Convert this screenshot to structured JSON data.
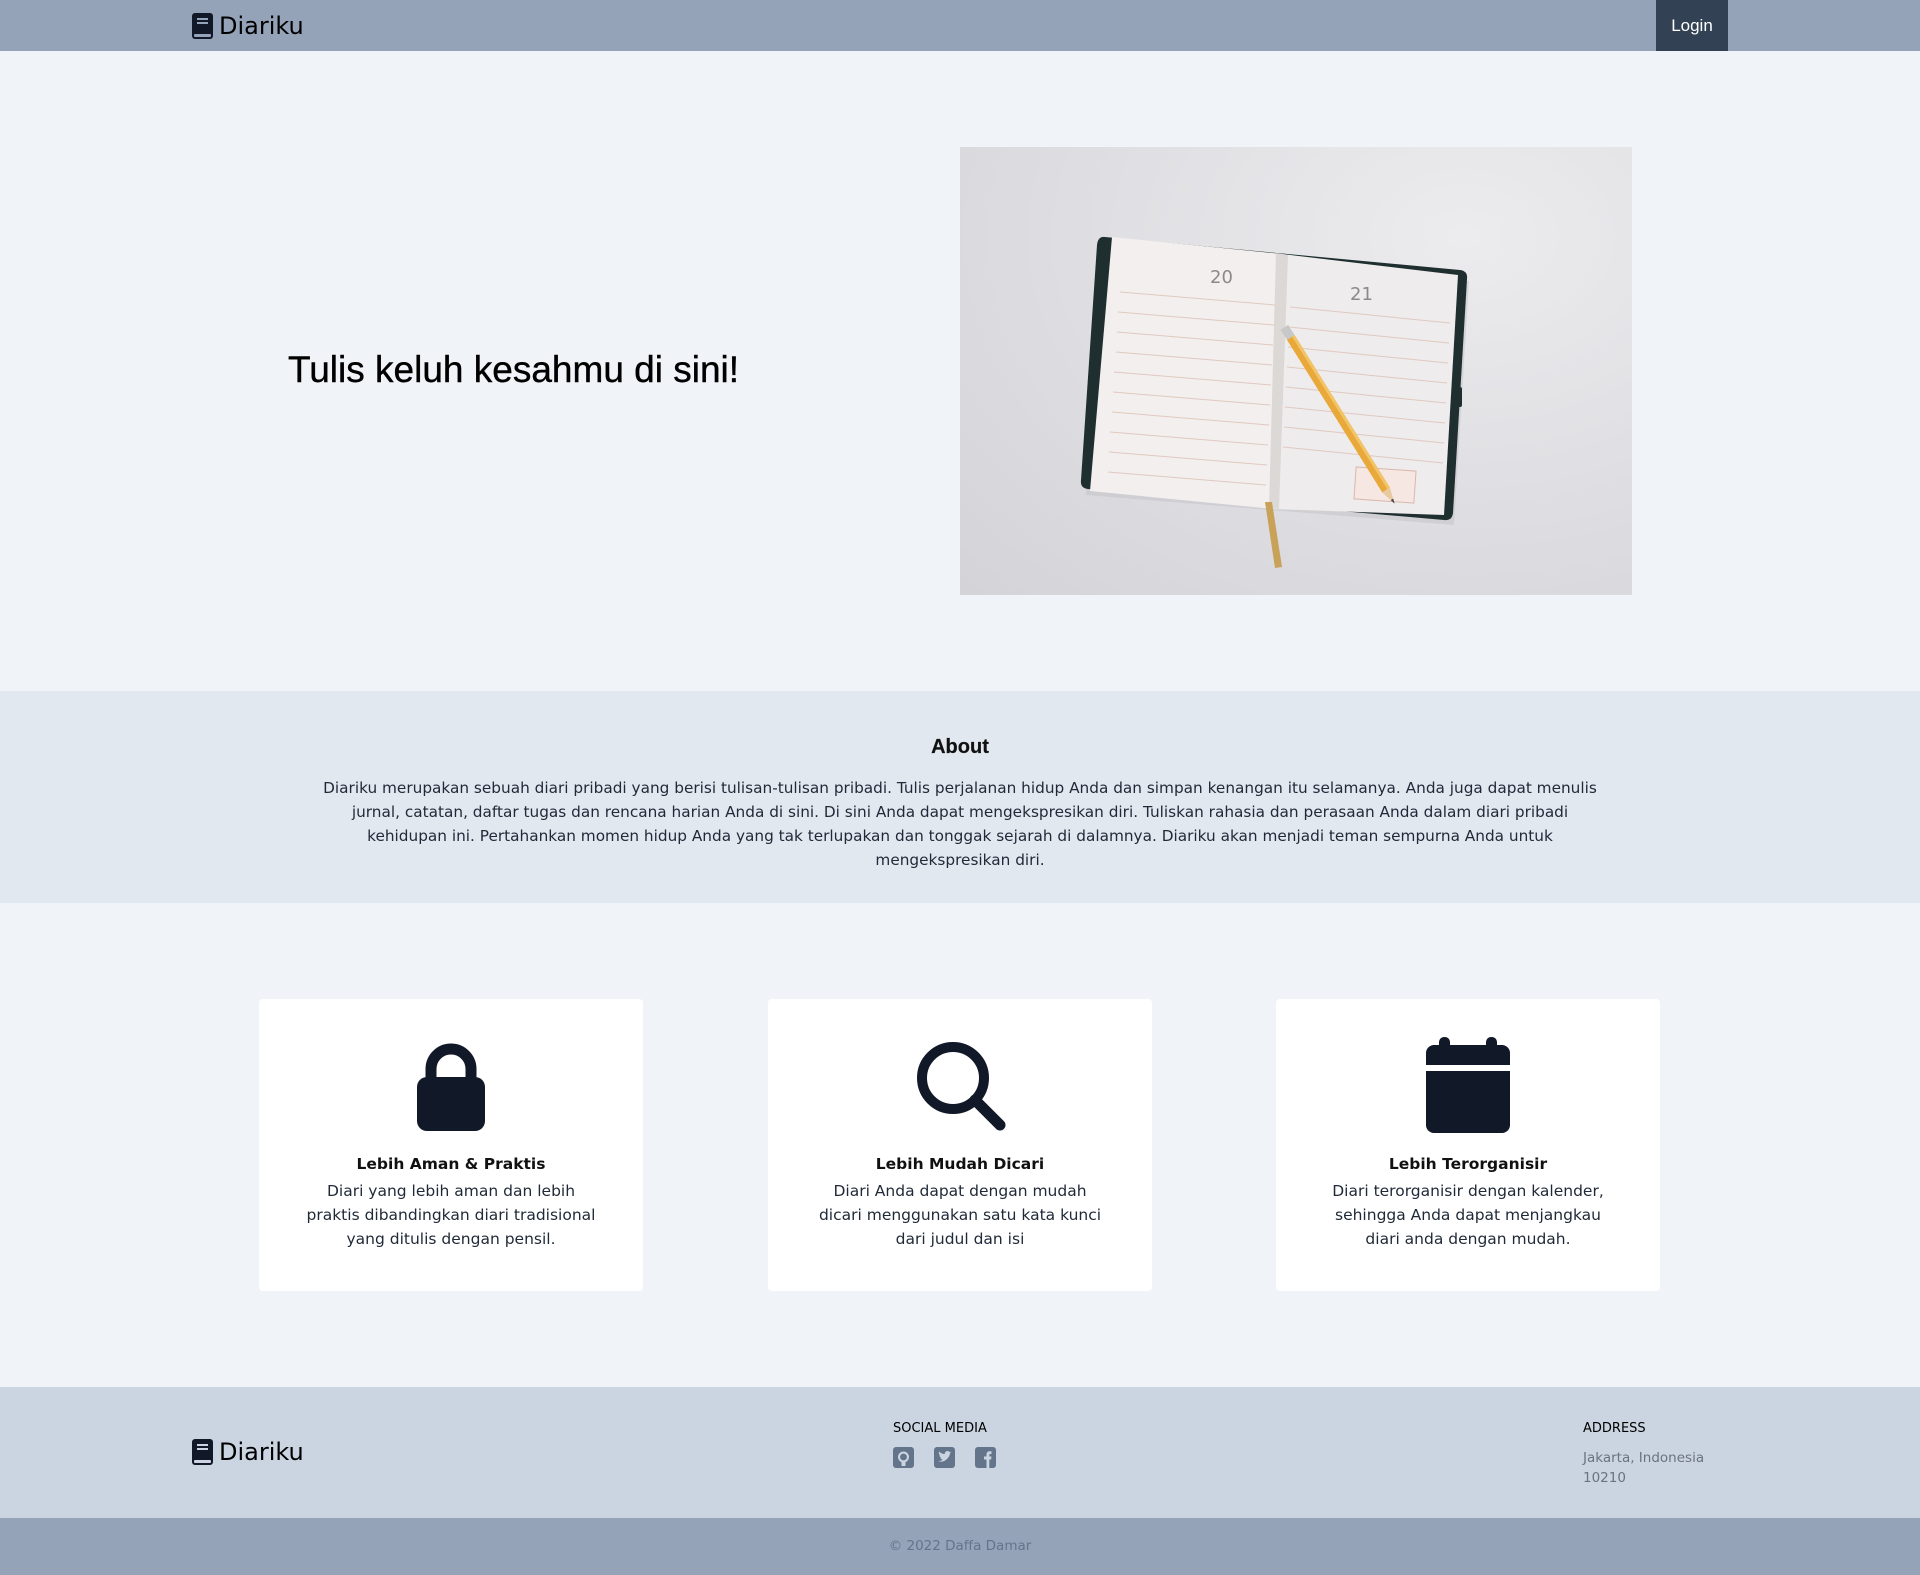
{
  "navbar": {
    "brand": "Diariku",
    "brand_icon": "book-icon",
    "login_label": "Login",
    "background": "#94a3b8",
    "login_background": "#334155"
  },
  "hero": {
    "title": "Tulis keluh kesahmu di sini!",
    "image_alt": "open-diary-with-pencil-photo",
    "image_page_numbers": [
      "20",
      "21"
    ]
  },
  "about": {
    "title": "About",
    "text": "Diariku merupakan sebuah diari pribadi yang berisi tulisan-tulisan pribadi. Tulis perjalanan hidup Anda dan simpan kenangan itu selamanya. Anda juga dapat menulis jurnal, catatan, daftar tugas dan rencana harian Anda di sini. Di sini Anda dapat mengekspresikan diri. Tuliskan rahasia dan perasaan Anda dalam diari pribadi kehidupan ini. Pertahankan momen hidup Anda yang tak terlupakan dan tonggak sejarah di dalamnya. Diariku akan menjadi teman sempurna Anda untuk mengekspresikan diri."
  },
  "features": [
    {
      "icon": "lock-icon",
      "title": "Lebih Aman & Praktis",
      "description": "Diari yang lebih aman dan lebih praktis dibandingkan diari tradisional yang ditulis dengan pensil."
    },
    {
      "icon": "search-icon",
      "title": "Lebih Mudah Dicari",
      "description": "Diari Anda dapat dengan mudah dicari menggunakan satu kata kunci dari judul dan isi"
    },
    {
      "icon": "calendar-icon",
      "title": "Lebih Terorganisir",
      "description": "Diari terorganisir dengan kalender, sehingga Anda dapat menjangkau diari anda dengan mudah."
    }
  ],
  "footer": {
    "brand": "Diariku",
    "social_heading": "SOCIAL MEDIA",
    "social_icons": [
      "github-icon",
      "twitter-icon",
      "facebook-icon"
    ],
    "address_heading": "ADDRESS",
    "address_line1": "Jakarta, Indonesia",
    "address_line2": "10210",
    "copyright": "© 2022  Daffa Damar"
  },
  "colors": {
    "page_background": "#f0f4f8",
    "about_background": "#e2e8f0",
    "footer_background": "#cbd5e1",
    "icon_color": "#111827"
  }
}
